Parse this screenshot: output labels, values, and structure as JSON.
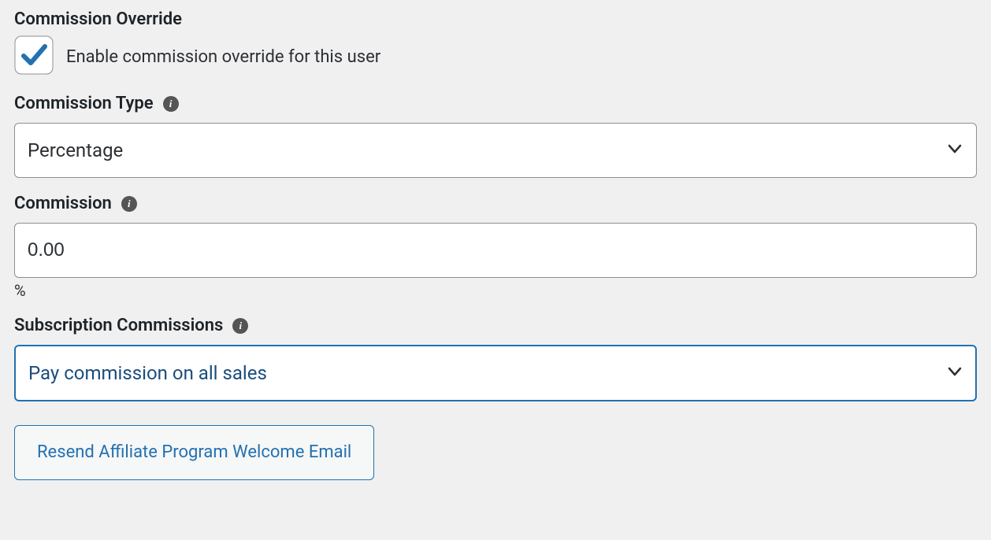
{
  "override": {
    "label": "Commission Override",
    "checkbox_label": "Enable commission override for this user",
    "checked": true
  },
  "type": {
    "label": "Commission Type",
    "selected": "Percentage"
  },
  "commission": {
    "label": "Commission",
    "value": "0.00",
    "unit": "%"
  },
  "subscriptions": {
    "label": "Subscription Commissions",
    "selected": "Pay commission on all sales"
  },
  "resend_button": "Resend Affiliate Program Welcome Email"
}
